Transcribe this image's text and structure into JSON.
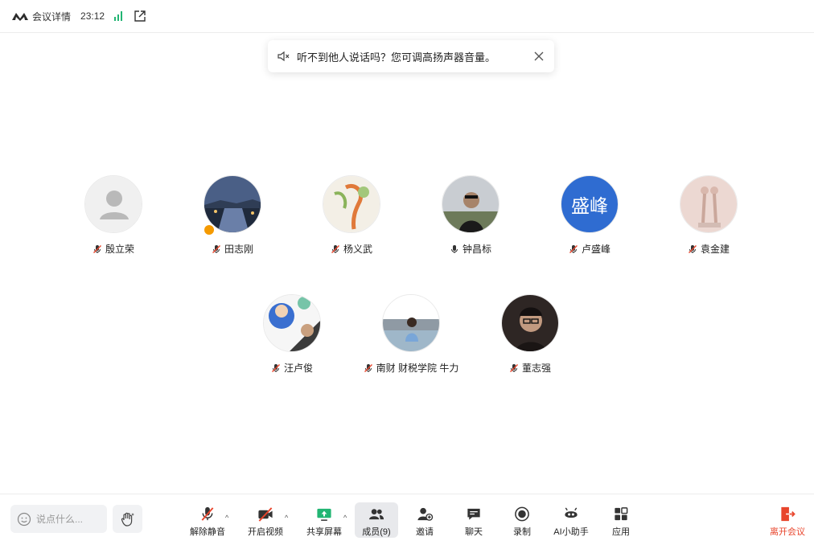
{
  "header": {
    "meeting_details": "会议详情",
    "time": "23:12",
    "signal_color": "#22b573"
  },
  "toast": {
    "text": "听不到他人说话吗？您可调高扬声器音量。"
  },
  "participants": [
    {
      "name": "殷立荣",
      "mic": "muted",
      "avatar": "default"
    },
    {
      "name": "田志刚",
      "mic": "muted",
      "avatar": "photo-canal",
      "host": true
    },
    {
      "name": "杨义武",
      "mic": "muted",
      "avatar": "photo-flower"
    },
    {
      "name": "钟昌标",
      "mic": "on",
      "avatar": "photo-man"
    },
    {
      "name": "卢盛峰",
      "mic": "muted",
      "avatar": "text",
      "avatar_text": "盛峰",
      "avatar_color": "#2f6cd1"
    },
    {
      "name": "袁金建",
      "mic": "muted",
      "avatar": "photo-dancer"
    },
    {
      "name": "汪卢俊",
      "mic": "muted",
      "avatar": "photo-cartoon"
    },
    {
      "name": "南财 财税学院 牛力",
      "mic": "muted",
      "avatar": "photo-lake"
    },
    {
      "name": "董志强",
      "mic": "muted",
      "avatar": "photo-glasses"
    }
  ],
  "bottom": {
    "chat_placeholder": "说点什么...",
    "tools": {
      "unmute": "解除静音",
      "video": "开启视频",
      "share": "共享屏幕",
      "members": "成员(9)",
      "invite": "邀请",
      "chat": "聊天",
      "record": "录制",
      "ai": "AI小助手",
      "apps": "应用",
      "leave": "离开会议"
    },
    "accent_red": "#e8452c",
    "accent_green": "#22b573"
  }
}
